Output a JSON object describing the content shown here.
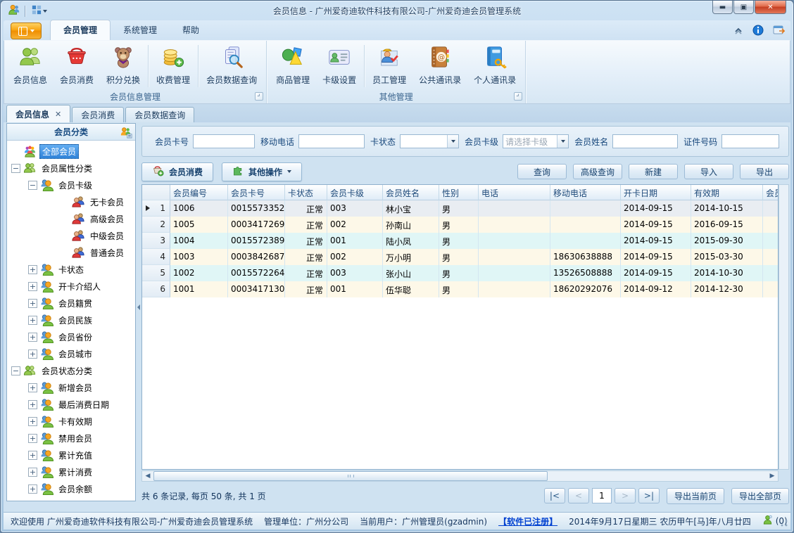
{
  "window": {
    "title": "会员信息 - 广州爱奇迪软件科技有限公司-广州爱奇迪会员管理系统"
  },
  "menu_tabs": [
    {
      "label": "会员管理",
      "active": true
    },
    {
      "label": "系统管理",
      "active": false
    },
    {
      "label": "帮助",
      "active": false
    }
  ],
  "ribbon": {
    "groups": [
      {
        "label": "会员信息管理",
        "buttons": [
          {
            "id": "member-info",
            "label": "会员信息",
            "icon": "member-info-icon",
            "sep_before": false
          },
          {
            "id": "member-consume",
            "label": "会员消费",
            "icon": "basket-icon",
            "sep_before": false
          },
          {
            "id": "points-exchange",
            "label": "积分兑换",
            "icon": "teddy-icon",
            "sep_before": false
          },
          {
            "id": "fee-manage",
            "label": "收费管理",
            "icon": "coins-icon",
            "sep_before": true
          },
          {
            "id": "member-data-query",
            "label": "会员数据查询",
            "icon": "search-docs-icon",
            "sep_before": true
          }
        ]
      },
      {
        "label": "其他管理",
        "buttons": [
          {
            "id": "goods-manage",
            "label": "商品管理",
            "icon": "goods-icon",
            "sep_before": false
          },
          {
            "id": "card-level-setting",
            "label": "卡级设置",
            "icon": "card-icon",
            "sep_before": false
          },
          {
            "id": "staff-manage",
            "label": "员工管理",
            "icon": "staff-icon",
            "sep_before": true
          },
          {
            "id": "public-contacts",
            "label": "公共通讯录",
            "icon": "public-book-icon",
            "sep_before": false
          },
          {
            "id": "personal-contacts",
            "label": "个人通讯录",
            "icon": "personal-book-icon",
            "sep_before": false
          }
        ]
      }
    ]
  },
  "doc_tabs": [
    {
      "id": "member-info",
      "label": "会员信息",
      "active": true,
      "closable": true
    },
    {
      "id": "member-consume",
      "label": "会员消费",
      "active": false,
      "closable": false
    },
    {
      "id": "member-data-query",
      "label": "会员数据查询",
      "active": false,
      "closable": false
    }
  ],
  "sidebar": {
    "title": "会员分类",
    "tree": [
      {
        "label": "全部会员",
        "level": 0,
        "exp": null,
        "icon": "all-members-icon",
        "selected": true
      },
      {
        "label": "会员属性分类",
        "level": 0,
        "exp": "minus",
        "icon": "member-group-icon",
        "selected": false
      },
      {
        "label": "会员卡级",
        "level": 1,
        "exp": "minus",
        "icon": "member-pair-icon",
        "selected": false
      },
      {
        "label": "无卡会员",
        "level": 2,
        "exp": null,
        "icon": "member-leaf-icon",
        "selected": false
      },
      {
        "label": "高级会员",
        "level": 2,
        "exp": null,
        "icon": "member-leaf-icon",
        "selected": false
      },
      {
        "label": "中级会员",
        "level": 2,
        "exp": null,
        "icon": "member-leaf-icon",
        "selected": false
      },
      {
        "label": "普通会员",
        "level": 2,
        "exp": null,
        "icon": "member-leaf-icon",
        "selected": false
      },
      {
        "label": "卡状态",
        "level": 1,
        "exp": "plus",
        "icon": "member-pair-icon",
        "selected": false
      },
      {
        "label": "开卡介绍人",
        "level": 1,
        "exp": "plus",
        "icon": "member-pair-icon",
        "selected": false
      },
      {
        "label": "会员籍贯",
        "level": 1,
        "exp": "plus",
        "icon": "member-pair-icon",
        "selected": false
      },
      {
        "label": "会员民族",
        "level": 1,
        "exp": "plus",
        "icon": "member-pair-icon",
        "selected": false
      },
      {
        "label": "会员省份",
        "level": 1,
        "exp": "plus",
        "icon": "member-pair-icon",
        "selected": false
      },
      {
        "label": "会员城市",
        "level": 1,
        "exp": "plus",
        "icon": "member-pair-icon",
        "selected": false
      },
      {
        "label": "会员状态分类",
        "level": 0,
        "exp": "minus",
        "icon": "member-group-icon",
        "selected": false
      },
      {
        "label": "新增会员",
        "level": 1,
        "exp": "plus",
        "icon": "member-pair-icon",
        "selected": false
      },
      {
        "label": "最后消费日期",
        "level": 1,
        "exp": "plus",
        "icon": "member-pair-icon",
        "selected": false
      },
      {
        "label": "卡有效期",
        "level": 1,
        "exp": "plus",
        "icon": "member-pair-icon",
        "selected": false
      },
      {
        "label": "禁用会员",
        "level": 1,
        "exp": "plus",
        "icon": "member-pair-icon",
        "selected": false
      },
      {
        "label": "累计充值",
        "level": 1,
        "exp": "plus",
        "icon": "member-pair-icon",
        "selected": false
      },
      {
        "label": "累计消费",
        "level": 1,
        "exp": "plus",
        "icon": "member-pair-icon",
        "selected": false
      },
      {
        "label": "会员余额",
        "level": 1,
        "exp": "plus",
        "icon": "member-pair-icon",
        "selected": false
      }
    ]
  },
  "filters": [
    {
      "id": "member-card-no",
      "label": "会员卡号",
      "type": "input",
      "value": ""
    },
    {
      "id": "mobile-phone",
      "label": "移动电话",
      "type": "input",
      "value": ""
    },
    {
      "id": "card-status",
      "label": "卡状态",
      "type": "select",
      "value": "",
      "placeholder": false
    },
    {
      "id": "card-level",
      "label": "会员卡级",
      "type": "select",
      "value": "请选择卡级",
      "placeholder": true
    },
    {
      "id": "member-name",
      "label": "会员姓名",
      "type": "input",
      "value": ""
    },
    {
      "id": "id-number",
      "label": "证件号码",
      "type": "input",
      "value": ""
    }
  ],
  "actions": {
    "member_consume": "会员消费",
    "other_ops": "其他操作",
    "right_buttons": [
      {
        "id": "query",
        "label": "查询"
      },
      {
        "id": "advanced-query",
        "label": "高级查询"
      },
      {
        "id": "new",
        "label": "新建"
      },
      {
        "id": "import",
        "label": "导入"
      },
      {
        "id": "export",
        "label": "导出"
      }
    ]
  },
  "grid": {
    "columns": [
      "会员编号",
      "会员卡号",
      "卡状态",
      "会员卡级",
      "会员姓名",
      "性别",
      "电话",
      "移动电话",
      "开卡日期",
      "有效期",
      "会员"
    ],
    "rows": [
      {
        "num": "1",
        "current": true,
        "cells": [
          "1006",
          "0015573352",
          "正常",
          "003",
          "林小宝",
          "男",
          "",
          "",
          "2014-09-15",
          "2014-10-15",
          ""
        ]
      },
      {
        "num": "2",
        "current": false,
        "cells": [
          "1005",
          "0003417269",
          "正常",
          "002",
          "孙南山",
          "男",
          "",
          "",
          "2014-09-15",
          "2016-09-15",
          ""
        ]
      },
      {
        "num": "3",
        "current": false,
        "cells": [
          "1004",
          "0015572389",
          "正常",
          "001",
          "陆小凤",
          "男",
          "",
          "",
          "2014-09-15",
          "2015-09-30",
          ""
        ]
      },
      {
        "num": "4",
        "current": false,
        "cells": [
          "1003",
          "0003842687",
          "正常",
          "002",
          "万小明",
          "男",
          "",
          "18630638888",
          "2014-09-15",
          "2015-03-30",
          ""
        ]
      },
      {
        "num": "5",
        "current": false,
        "cells": [
          "1002",
          "0015572264",
          "正常",
          "003",
          "张小山",
          "男",
          "",
          "13526508888",
          "2014-09-15",
          "2014-10-30",
          ""
        ]
      },
      {
        "num": "6",
        "current": false,
        "cells": [
          "1001",
          "0003417130",
          "正常",
          "001",
          "伍华聪",
          "男",
          "",
          "18620292076",
          "2014-09-12",
          "2014-12-30",
          ""
        ]
      }
    ]
  },
  "pagination": {
    "summary": "共 6 条记录, 每页 50 条, 共 1 页",
    "nav": [
      {
        "id": "first-page",
        "label": "|<",
        "enabled": true
      },
      {
        "id": "prev-page",
        "label": "<",
        "enabled": false
      },
      {
        "id": "next-page",
        "label": ">",
        "enabled": false
      },
      {
        "id": "last-page",
        "label": ">|",
        "enabled": true
      }
    ],
    "page": "1",
    "export_current": "导出当前页",
    "export_all": "导出全部页"
  },
  "statusbar": {
    "welcome": "欢迎使用 广州爱奇迪软件科技有限公司-广州爱奇迪会员管理系统",
    "org": "管理单位：广州分公司",
    "user": "当前用户：广州管理员(gzadmin)",
    "registered": "【软件已注册】",
    "date": "2014年9月17日星期三 农历甲午[马]年八月廿四",
    "online": "(0)"
  }
}
